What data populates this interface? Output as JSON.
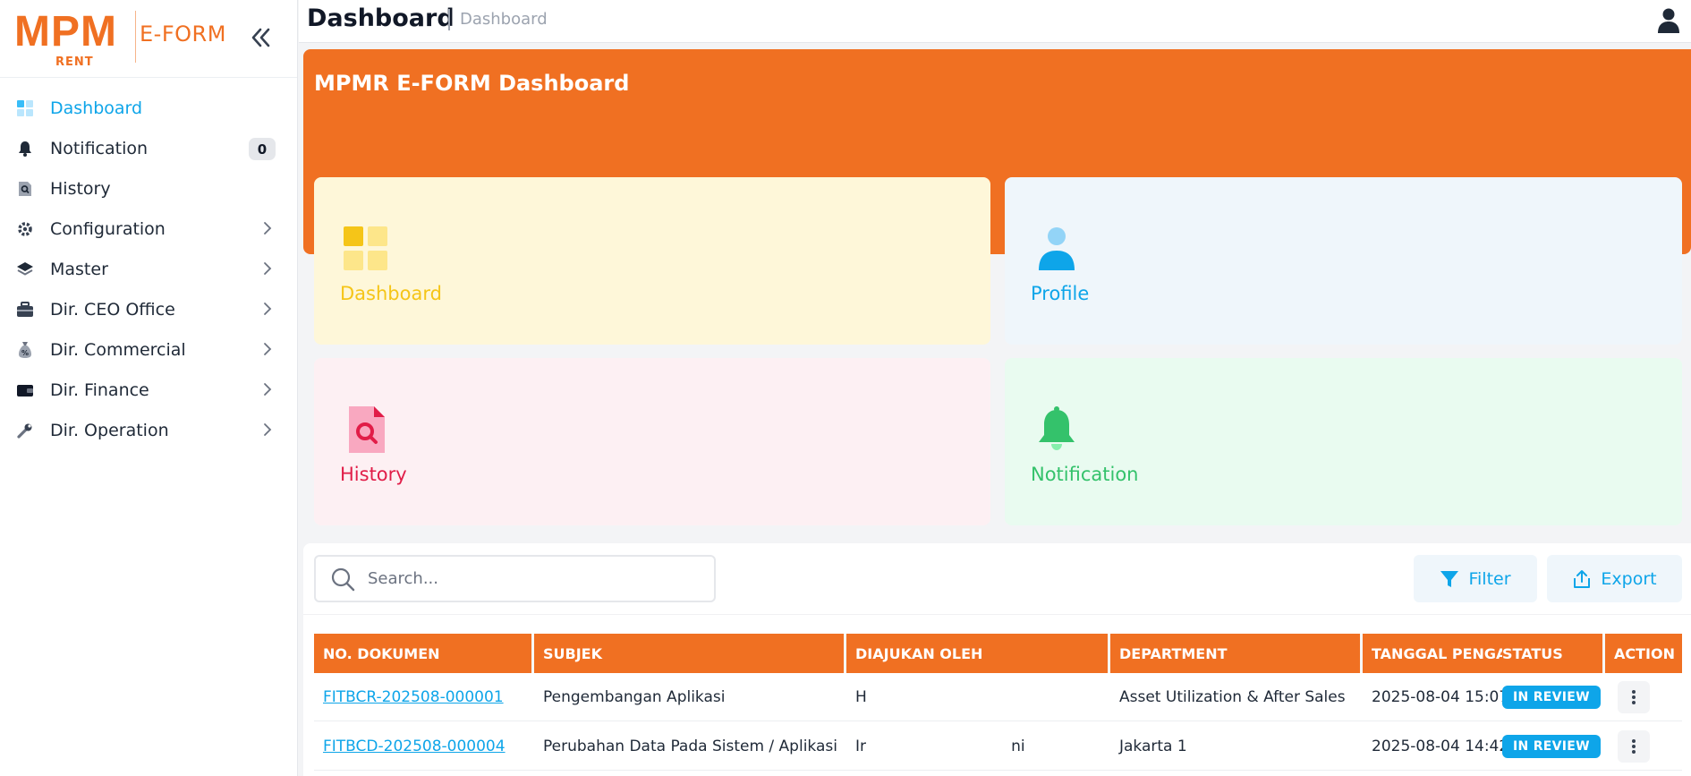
{
  "brand": {
    "logo_text": "MPM",
    "logo_sub": "RENT",
    "app_name": "E-FORM"
  },
  "sidebar": {
    "items": [
      {
        "label": "Dashboard",
        "icon": "grid-icon",
        "active": true
      },
      {
        "label": "Notification",
        "icon": "bell-icon",
        "badge": "0"
      },
      {
        "label": "History",
        "icon": "document-search-icon"
      },
      {
        "label": "Configuration",
        "icon": "gear-icon",
        "has_children": true
      },
      {
        "label": "Master",
        "icon": "layers-icon",
        "has_children": true
      },
      {
        "label": "Dir. CEO Office",
        "icon": "briefcase-icon",
        "has_children": true
      },
      {
        "label": "Dir. Commercial",
        "icon": "money-bag-icon",
        "has_children": true
      },
      {
        "label": "Dir. Finance",
        "icon": "wallet-icon",
        "has_children": true
      },
      {
        "label": "Dir. Operation",
        "icon": "wrench-icon",
        "has_children": true
      }
    ]
  },
  "header": {
    "title": "Dashboard",
    "breadcrumb": "Dashboard",
    "user_icon": "user-icon"
  },
  "banner": {
    "title": "MPMR E-FORM Dashboard"
  },
  "cards": {
    "dashboard": {
      "label": "Dashboard",
      "icon": "grid-icon"
    },
    "profile": {
      "label": "Profile",
      "icon": "user-icon"
    },
    "history": {
      "label": "History",
      "icon": "document-search-icon"
    },
    "notification": {
      "label": "Notification",
      "icon": "bell-icon"
    }
  },
  "toolbar": {
    "search_placeholder": "Search...",
    "filter_label": "Filter",
    "export_label": "Export"
  },
  "table": {
    "columns": [
      "NO. DOKUMEN",
      "SUBJEK",
      "DIAJUKAN OLEH",
      "DEPARTMENT",
      "TANGGAL PENGAJ",
      "STATUS",
      "ACTION"
    ],
    "rows": [
      {
        "no_dokumen": "FITBCR-202508-000001",
        "subjek": "Pengembangan Aplikasi",
        "diajukan_oleh": "H",
        "department": "Asset Utilization & After Sales",
        "tanggal": "2025-08-04 15:07",
        "status": "IN REVIEW"
      },
      {
        "no_dokumen": "FITBCD-202508-000004",
        "subjek": "Perubahan Data Pada Sistem / Aplikasi",
        "diajukan_oleh": "Ir                              ni",
        "department": "Jakarta 1",
        "tanggal": "2025-08-04 14:42",
        "status": "IN REVIEW"
      }
    ]
  },
  "colors": {
    "brand": "#f07022",
    "accent": "#0ea5e9",
    "status_review": "#0ea5e9"
  }
}
